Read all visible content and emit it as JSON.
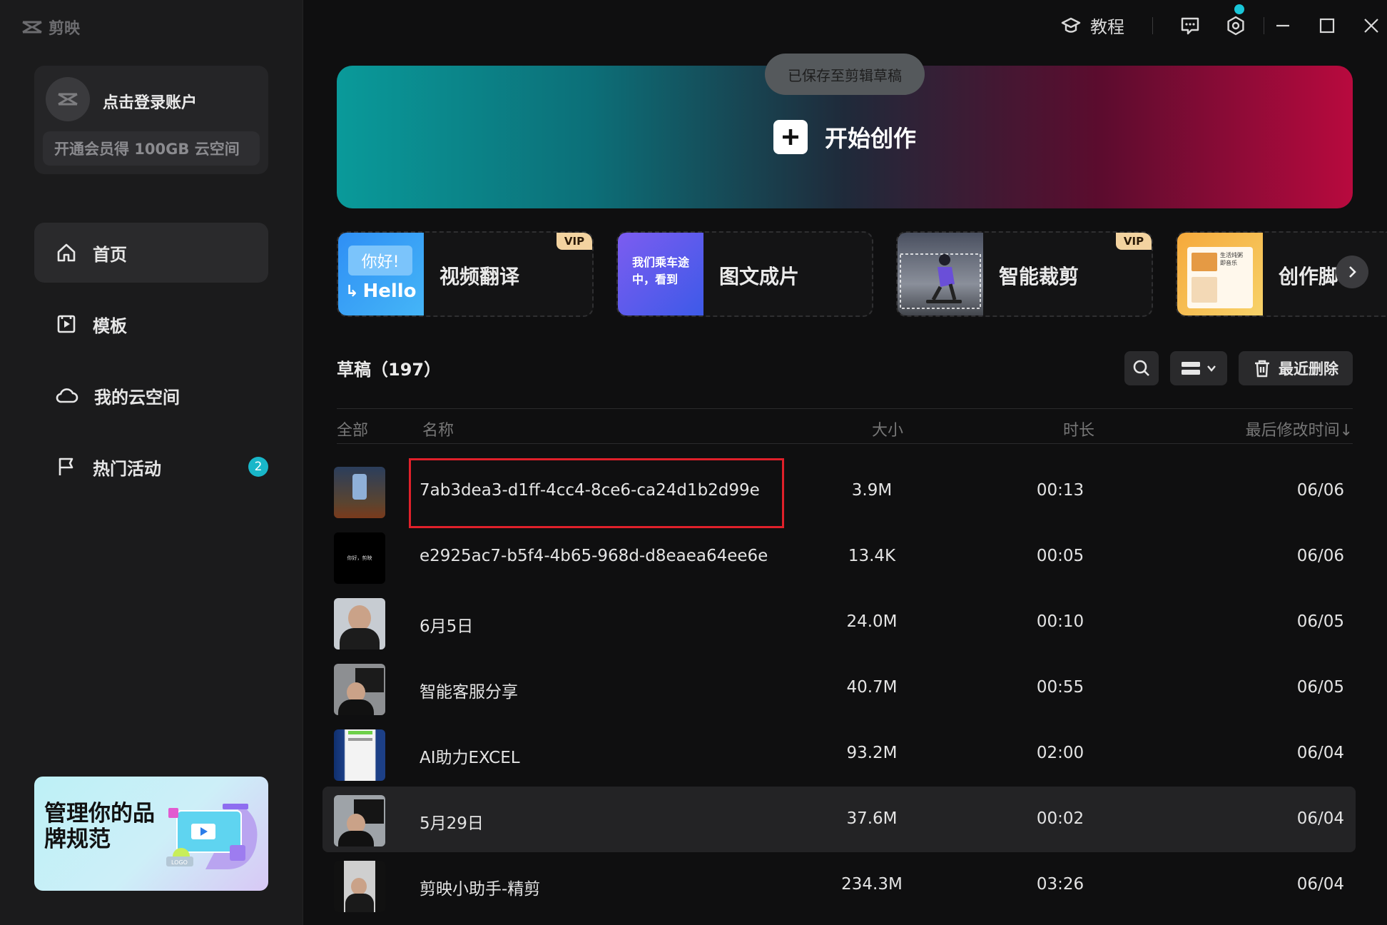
{
  "app": {
    "name": "剪映"
  },
  "account": {
    "login_label": "点击登录账户",
    "storage_promo": "开通会员得 100GB 云空间"
  },
  "nav": [
    {
      "label": "首页",
      "icon": "home-icon",
      "active": true
    },
    {
      "label": "模板",
      "icon": "template-icon"
    },
    {
      "label": "我的云空间",
      "icon": "cloud-icon"
    },
    {
      "label": "热门活动",
      "icon": "flag-icon",
      "badge": "2"
    }
  ],
  "promo_banner": {
    "text": "管理你的品牌规范",
    "tag": "LOGO"
  },
  "titlebar": {
    "tutorial_label": "教程"
  },
  "hero": {
    "toast": "已保存至剪辑草稿",
    "create_label": "开始创作"
  },
  "tools": [
    {
      "label": "视频翻译",
      "vip": "VIP",
      "thumb_text_1": "你好!",
      "thumb_text_2": "Hello"
    },
    {
      "label": "图文成片",
      "thumb_text_1": "我们乘车途",
      "thumb_text_2": "中，看到"
    },
    {
      "label": "智能裁剪",
      "vip": "VIP"
    },
    {
      "label": "创作脚",
      "thumb_text_1": "生活炖粥",
      "thumb_text_2": "即音乐"
    }
  ],
  "drafts": {
    "title": "草稿（197）",
    "recycle_label": "最近删除",
    "columns": {
      "all": "全部",
      "name": "名称",
      "size": "大小",
      "duration": "时长",
      "modified": "最后修改时间↓"
    },
    "rows": [
      {
        "name": "7ab3dea3-d1ff-4cc4-8ce6-ca24d1b2d99e",
        "size": "3.9M",
        "duration": "00:13",
        "date": "06/06",
        "thumb_color": "#3b4a60"
      },
      {
        "name": "e2925ac7-b5f4-4b65-968d-d8eaea64ee6e",
        "size": "13.4K",
        "duration": "00:05",
        "date": "06/06",
        "thumb_color": "#000000",
        "thumb_text": "你好，剪映"
      },
      {
        "name": "6月5日",
        "size": "24.0M",
        "duration": "00:10",
        "date": "06/05",
        "thumb_color": "#c7ccd2"
      },
      {
        "name": "智能客服分享",
        "size": "40.7M",
        "duration": "00:55",
        "date": "06/05",
        "thumb_color": "#8d8f92"
      },
      {
        "name": "AI助力EXCEL",
        "size": "93.2M",
        "duration": "02:00",
        "date": "06/04",
        "thumb_color": "#1c3f86"
      },
      {
        "name": "5月29日",
        "size": "37.6M",
        "duration": "00:02",
        "date": "06/04",
        "thumb_color": "#9ea3a8"
      },
      {
        "name": "剪映小助手-精剪",
        "size": "234.3M",
        "duration": "03:26",
        "date": "06/04",
        "thumb_color": "#cfcfcf"
      }
    ]
  }
}
